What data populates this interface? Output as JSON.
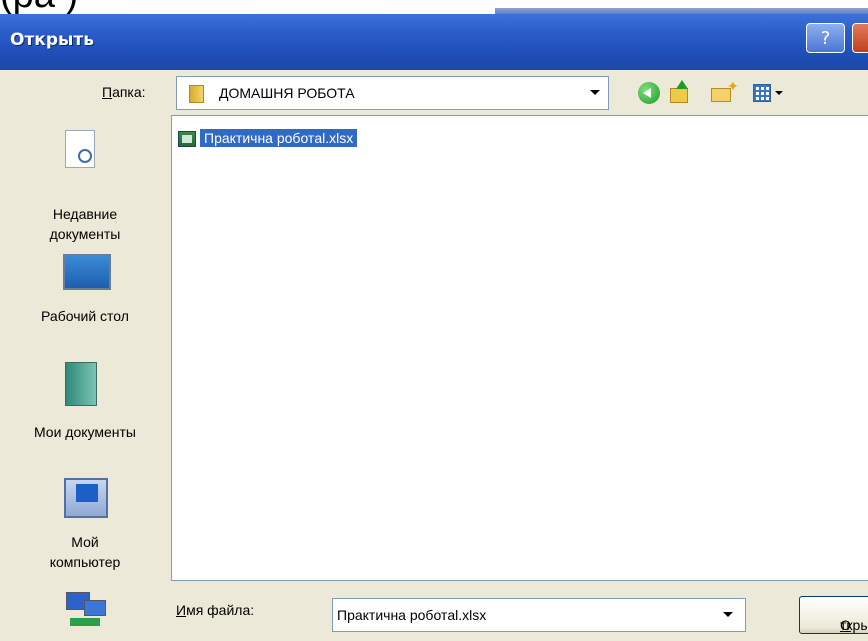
{
  "window": {
    "title": "Открыть",
    "help_glyph": "?"
  },
  "top_fragment": "(ра    )",
  "toolbar": {
    "folder_label_accel": "П",
    "folder_label_rest": "апка:",
    "folder_value": "ДОМАШНЯ РОБОТА",
    "icons": [
      "back-icon",
      "up-folder-icon",
      "new-folder-icon",
      "views-icon"
    ]
  },
  "places": [
    {
      "label_line1": "Недавние",
      "label_line2": "документы",
      "icon": "recent-documents-icon"
    },
    {
      "label_line1": "Рабочий стол",
      "label_line2": "",
      "icon": "desktop-icon"
    },
    {
      "label_line1": "Мои документы",
      "label_line2": "",
      "icon": "my-documents-icon"
    },
    {
      "label_line1": "Мой",
      "label_line2": "компьютер",
      "icon": "my-computer-icon"
    },
    {
      "label_line1": "",
      "label_line2": "",
      "icon": "network-icon"
    }
  ],
  "files": [
    {
      "name": "Практична роботal.xlsx",
      "selected": true,
      "icon": "excel-file-icon"
    }
  ],
  "footer": {
    "filename_label_accel": "И",
    "filename_label_rest": "мя файла:",
    "filename_value": "Практична роботal.xlsx",
    "open_button_accel": "О",
    "open_button_rest": "ткрыть"
  },
  "colors": {
    "titlebar": "#2a5cc9",
    "selection": "#316ac5",
    "dialog_bg": "#ece9d8"
  }
}
